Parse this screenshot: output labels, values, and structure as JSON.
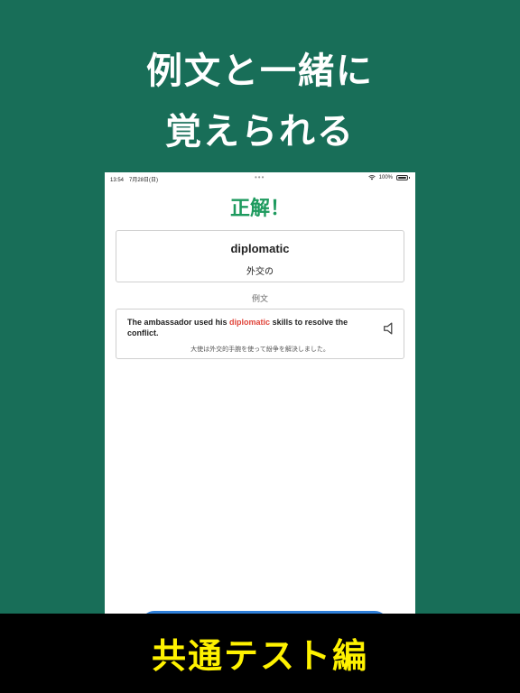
{
  "promo": {
    "line1": "例文と一緒に",
    "line2": "覚えられる",
    "banner": "共通テスト編"
  },
  "status_bar": {
    "time": "13:54",
    "date": "7月28日(日)",
    "dots": "•••",
    "battery": "100%"
  },
  "screen": {
    "result_title": "正解！",
    "word": "diplomatic",
    "meaning": "外交の",
    "example_label": "例文",
    "sentence_before": "The ambassador used his ",
    "sentence_highlight": "diplomatic",
    "sentence_after": " skills to resolve the conflict.",
    "translation": "大使は外交的手腕を使って紛争を解決しました。"
  },
  "icons": {
    "speaker": "speaker-icon",
    "wifi": "wifi-icon",
    "battery": "battery-icon"
  },
  "colors": {
    "background": "#186e58",
    "correct_green": "#1d9a5e",
    "highlight_red": "#e0443a",
    "banner_yellow": "#fff200",
    "button_blue": "#2f7fd8"
  }
}
